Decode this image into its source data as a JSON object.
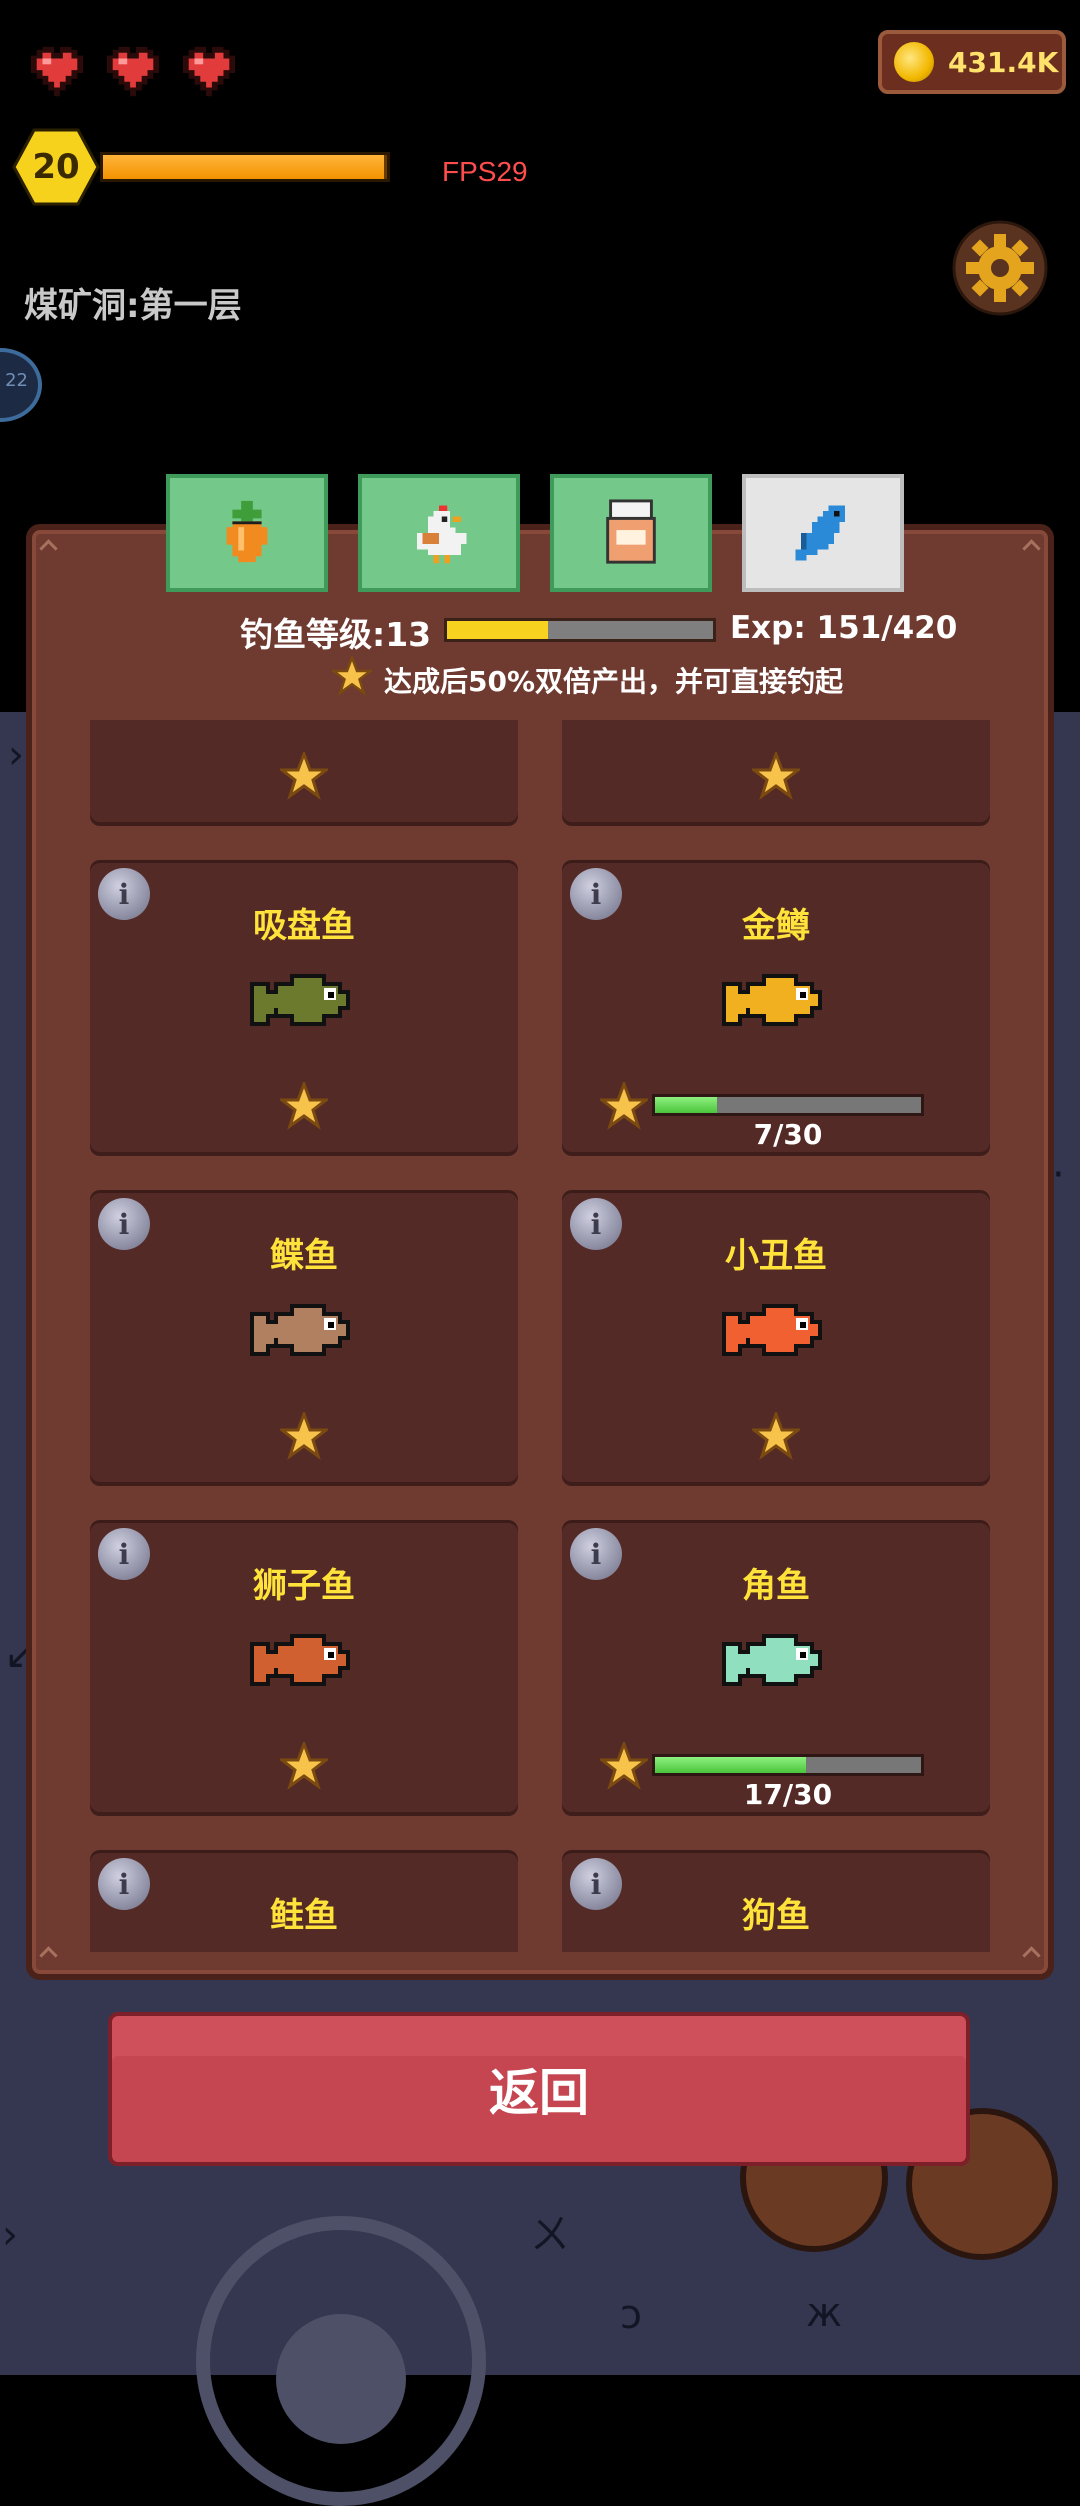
{
  "hud": {
    "hearts": [
      "heart",
      "heart",
      "heart"
    ],
    "level": "20",
    "xp_fraction": 0.99,
    "fps": "FPS29",
    "coins": "431.4K",
    "location": "煤矿洞:第一层",
    "side_badge": "22"
  },
  "tabs": [
    {
      "name": "farming",
      "icon": "carrot-icon",
      "active": false
    },
    {
      "name": "animals",
      "icon": "chicken-icon",
      "active": false
    },
    {
      "name": "crafting",
      "icon": "jar-icon",
      "active": false
    },
    {
      "name": "fishing",
      "icon": "fish-icon",
      "active": true
    }
  ],
  "fishing": {
    "level_label": "钓鱼等级:13",
    "level_fraction": 0.38,
    "exp_text": "Exp: 151/420",
    "hint": "达成后50%双倍产出，并可直接钓起"
  },
  "cards": [
    {
      "name": "",
      "fish_color": "#9aa2b8",
      "has_bar": false
    },
    {
      "name": "",
      "fish_color": "#f0a040",
      "has_bar": false
    },
    {
      "name": "吸盘鱼",
      "fish_color": "#6b7a2c",
      "has_bar": false
    },
    {
      "name": "金鳟",
      "fish_color": "#f0b020",
      "has_bar": true,
      "progress_text": "7/30",
      "progress": 0.2333
    },
    {
      "name": "鲽鱼",
      "fish_color": "#b08060",
      "has_bar": false
    },
    {
      "name": "小丑鱼",
      "fish_color": "#f06030",
      "has_bar": false
    },
    {
      "name": "狮子鱼",
      "fish_color": "#d06030",
      "has_bar": false
    },
    {
      "name": "角鱼",
      "fish_color": "#90e0c0",
      "has_bar": true,
      "progress_text": "17/30",
      "progress": 0.5667
    },
    {
      "name": "鲑鱼",
      "fish_color": "#c08060",
      "has_bar": false
    },
    {
      "name": "狗鱼",
      "fish_color": "#708050",
      "has_bar": false
    }
  ],
  "return_label": "返回"
}
